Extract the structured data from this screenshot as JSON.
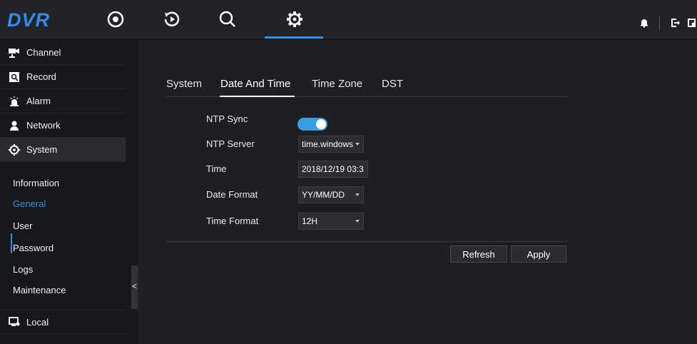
{
  "app": {
    "logo": "DVR"
  },
  "topnav": {
    "items": [
      {
        "name": "live-view",
        "icon": "record-circle-icon"
      },
      {
        "name": "playback",
        "icon": "playback-icon"
      },
      {
        "name": "search",
        "icon": "search-icon"
      },
      {
        "name": "settings",
        "icon": "gear-icon",
        "active": true
      }
    ],
    "right_icons": [
      "bell-icon",
      "logout-icon",
      "lock-icon"
    ]
  },
  "sidebar": {
    "main_items": [
      {
        "label": "Channel",
        "icon": "camera-icon"
      },
      {
        "label": "Record",
        "icon": "record-icon"
      },
      {
        "label": "Alarm",
        "icon": "alarm-icon"
      },
      {
        "label": "Network",
        "icon": "network-icon"
      },
      {
        "label": "System",
        "icon": "gear-icon",
        "active": true
      },
      {
        "label": "Local",
        "icon": "local-icon"
      }
    ],
    "sub_items": [
      {
        "label": "Information"
      },
      {
        "label": "General",
        "active": true
      },
      {
        "label": "User"
      },
      {
        "label": "Password"
      },
      {
        "label": "Logs"
      },
      {
        "label": "Maintenance"
      }
    ],
    "collapse_glyph": "<"
  },
  "tabs": [
    "System",
    "Date And Time",
    "Time Zone",
    "DST"
  ],
  "active_tab": "Date And Time",
  "form": {
    "ntp_sync": {
      "label": "NTP Sync",
      "value": "on"
    },
    "ntp_server": {
      "label": "NTP Server",
      "value": "time.windows"
    },
    "time": {
      "label": "Time",
      "value": "2018/12/19 03:3"
    },
    "date_format": {
      "label": "Date Format",
      "value": "YY/MM/DD"
    },
    "time_format": {
      "label": "Time Format",
      "value": "12H"
    }
  },
  "buttons": {
    "refresh": "Refresh",
    "apply": "Apply"
  },
  "colors": {
    "accent": "#2f8fe8",
    "toggle_on": "#3a9fe0",
    "background": "#1e1f24"
  }
}
